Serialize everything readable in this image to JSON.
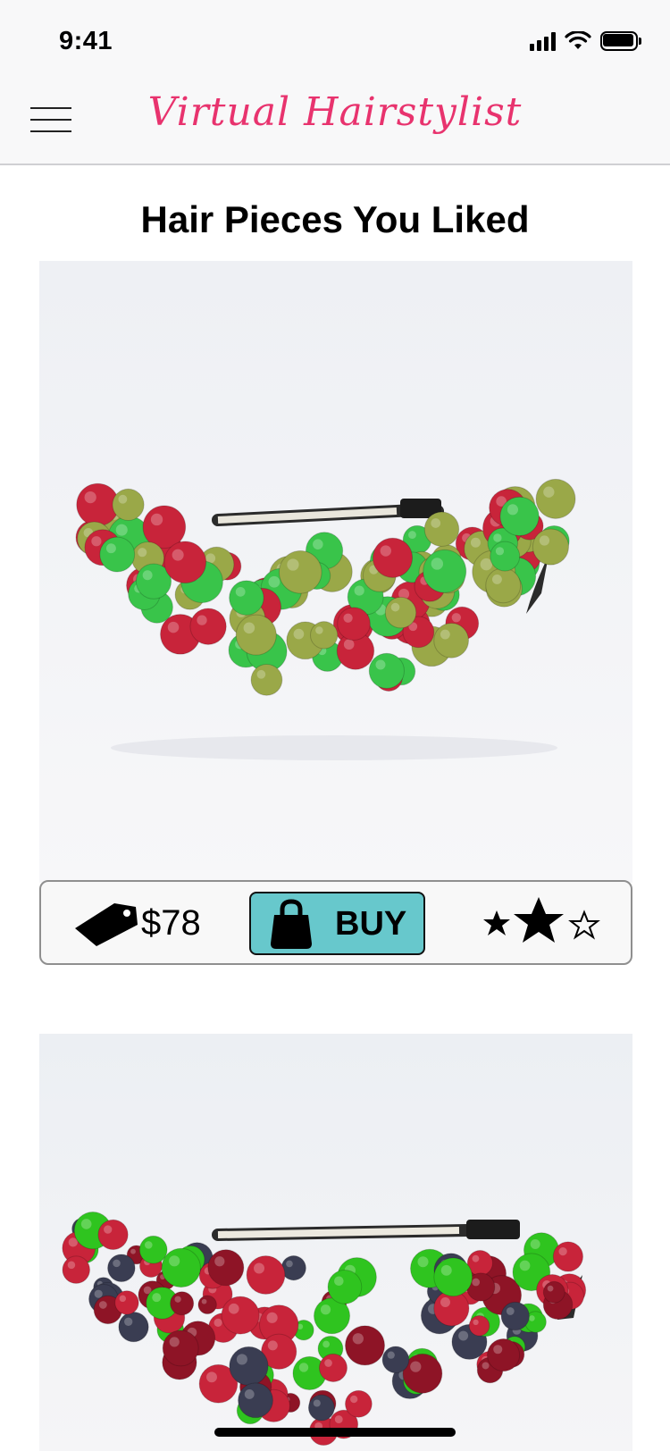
{
  "status_bar": {
    "time": "9:41"
  },
  "nav": {
    "title": "Virtual Hairstylist",
    "menu_icon": "hamburger-menu-icon"
  },
  "page": {
    "title": "Hair Pieces You Liked"
  },
  "products": [
    {
      "image_icon": "red-green-berry-headband",
      "price": "$78",
      "buy_label": "BUY",
      "rating_icons": [
        "star-filled-small",
        "star-filled-large",
        "star-outline-small"
      ],
      "colors": {
        "berry_red": "#c8243a",
        "berry_green": "#39c44a",
        "berry_olive": "#9aa848"
      }
    },
    {
      "image_icon": "dark-berry-rose-headband",
      "colors": {
        "berry_dark": "#3a3d52",
        "rose_red": "#8e1426",
        "berry_green": "#2fc41f"
      }
    }
  ],
  "colors": {
    "brand_pink": "#e8336e",
    "buy_button": "#67c8cc",
    "nav_bg": "#f8f8f9"
  }
}
